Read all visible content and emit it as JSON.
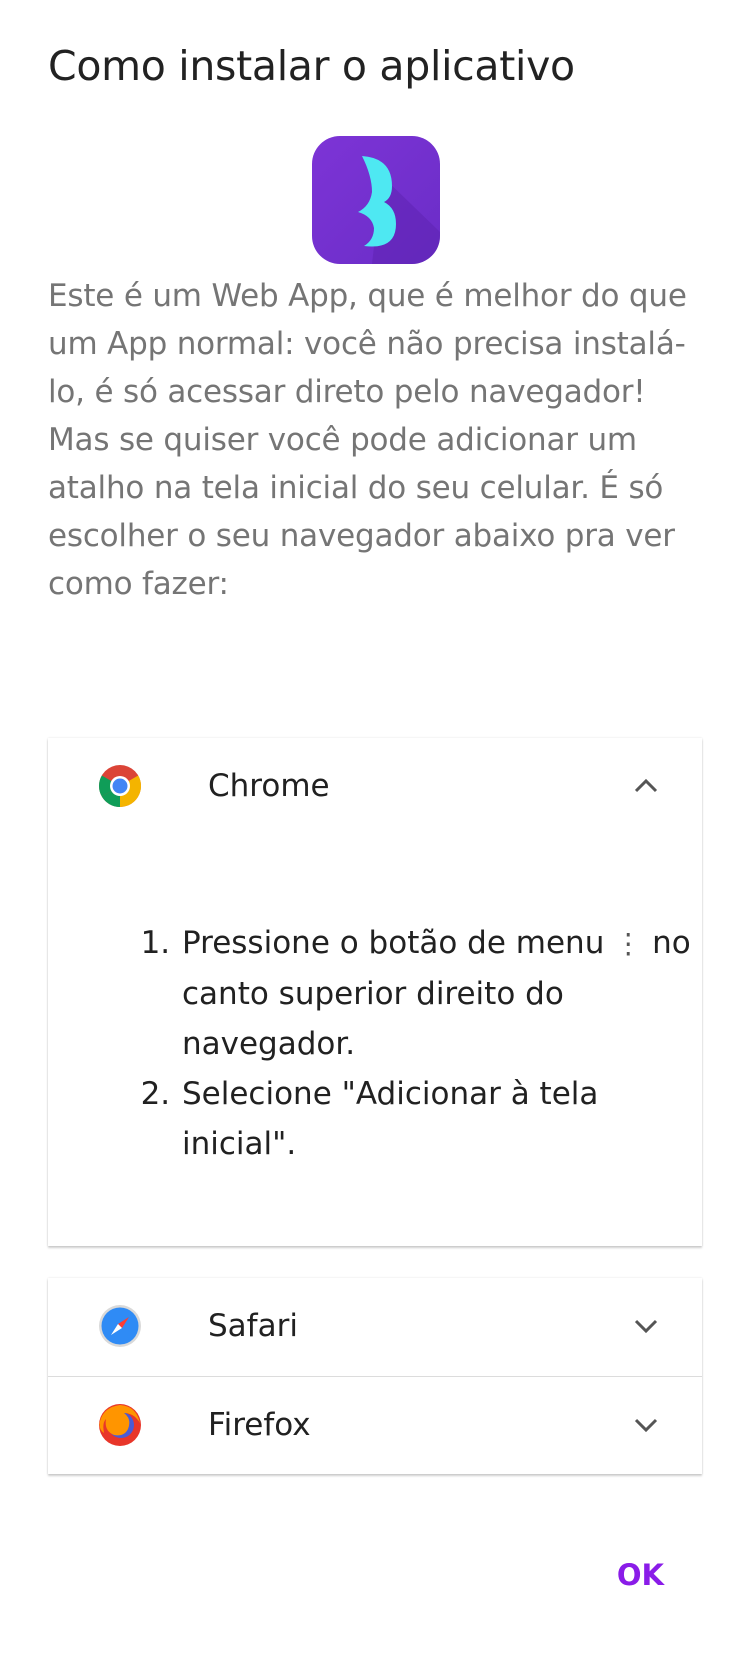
{
  "dialog": {
    "title": "Como instalar o aplicativo",
    "intro_paragraph_1": "Este é um Web App, que é melhor do que um App normal: você não precisa instalá-lo, é só acessar direto pelo navegador!",
    "intro_paragraph_2": "Mas se quiser você pode adicionar um atalho na tela inicial do seu celular. É só escolher o seu navegador abaixo pra ver como fazer:",
    "ok_label": "OK"
  },
  "browsers": [
    {
      "name": "Chrome",
      "icon": "chrome-icon",
      "expanded": true,
      "steps": [
        {
          "text": "Pressione o botão de menu",
          "icon": "more-vert-icon",
          "glyph": "⋮",
          "text_after": "no canto superior direito do navegador."
        },
        {
          "text": "Selecione \"Adicionar à tela inicial\"."
        }
      ]
    },
    {
      "name": "Safari",
      "icon": "safari-icon",
      "expanded": false
    },
    {
      "name": "Firefox",
      "icon": "firefox-icon",
      "expanded": false
    }
  ],
  "colors": {
    "accent": "#8a1ce8",
    "logo_purple": "#7d34d6",
    "logo_cyan": "#4ee8f2",
    "body_text": "#757575"
  }
}
